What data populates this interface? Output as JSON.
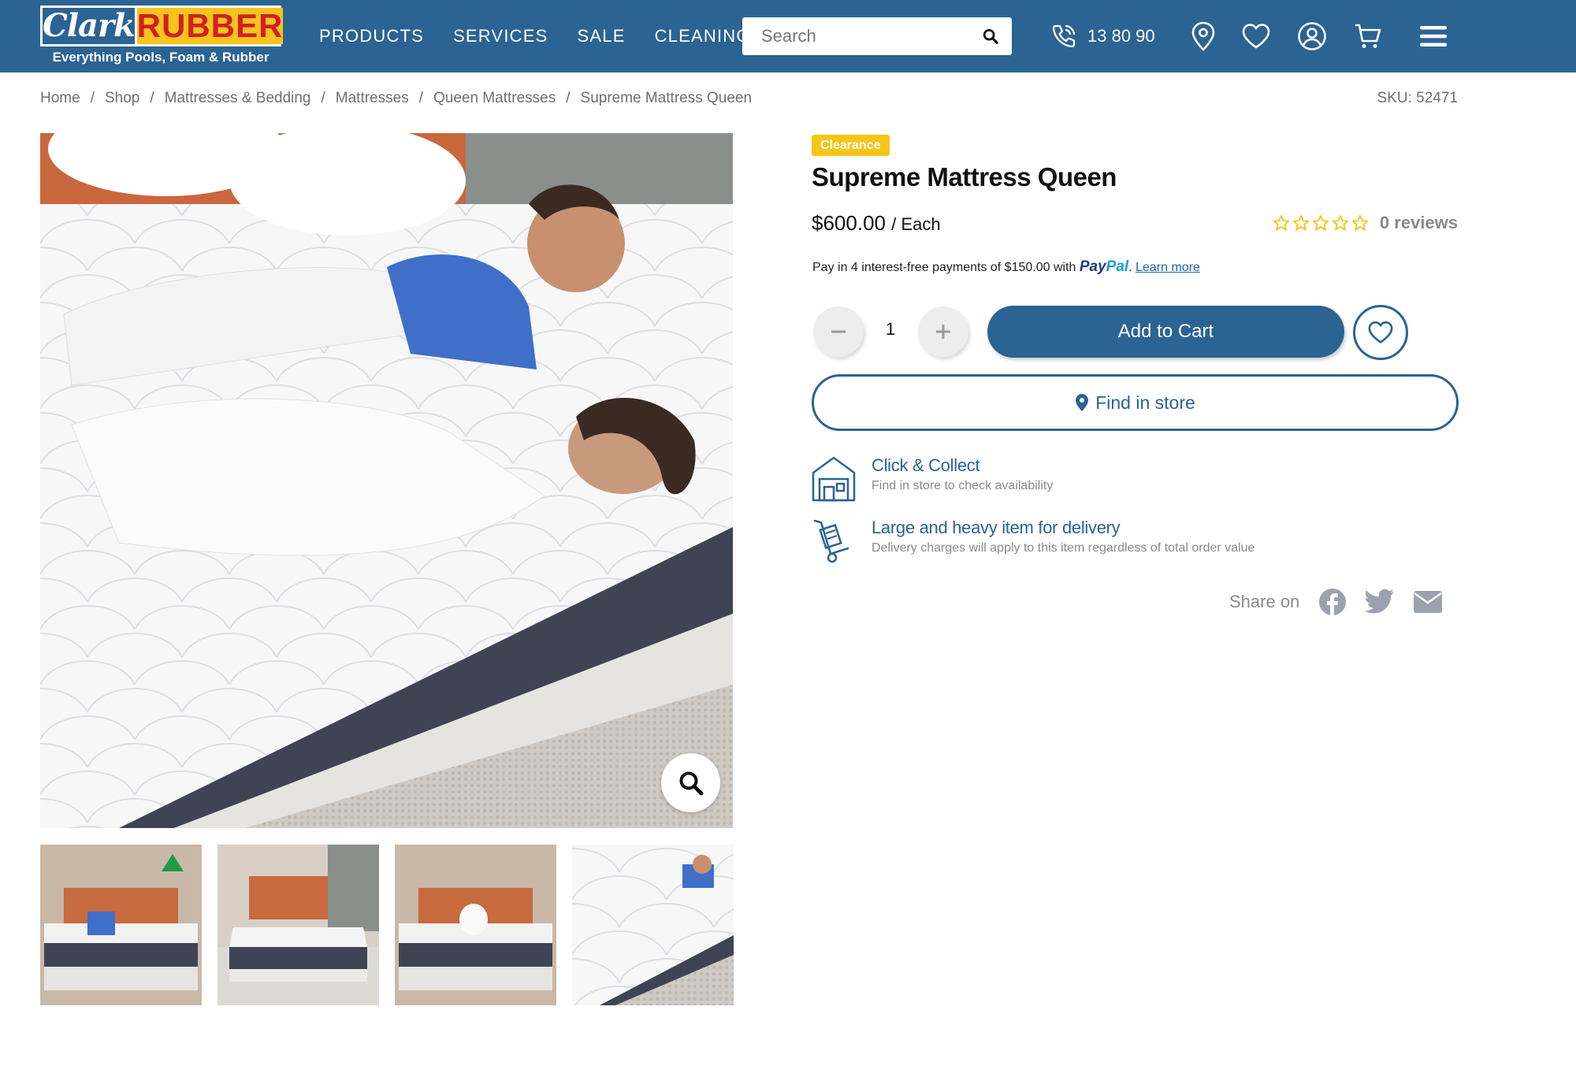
{
  "header": {
    "logo_left": "Clark",
    "logo_right": "RUBBER",
    "tagline": "Everything Pools, Foam & Rubber",
    "nav": [
      "PRODUCTS",
      "SERVICES",
      "SALE",
      "CLEANING"
    ],
    "search_placeholder": "Search",
    "phone": "13 80 90",
    "icons": [
      "search-icon",
      "phone-icon",
      "location-pin-icon",
      "heart-icon",
      "account-icon",
      "cart-icon",
      "menu-icon"
    ]
  },
  "breadcrumb": [
    "Home",
    "Shop",
    "Mattresses & Bedding",
    "Mattresses",
    "Queen Mattresses",
    "Supreme Mattress Queen"
  ],
  "sku": "SKU: 52471",
  "product": {
    "badge": "Clearance",
    "title": "Supreme Mattress Queen",
    "price": "$600.00",
    "unit": "/ Each",
    "rating": 0,
    "reviews": "0 reviews",
    "paypal_text": "Pay in 4 interest-free payments of $150.00 with",
    "paypal_brand_a": "Pay",
    "paypal_brand_b": "Pal",
    "paypal_link": "Learn more",
    "quantity": "1",
    "add_to_cart": "Add to Cart",
    "find_in_store": "Find in store"
  },
  "features": [
    {
      "title": "Click & Collect",
      "subtitle": "Find in store to check availability",
      "icon": "store-icon"
    },
    {
      "title": "Large and heavy item for delivery",
      "subtitle": "Delivery charges will apply to this item regardless of total order value",
      "icon": "hand-truck-icon"
    }
  ],
  "share": {
    "label": "Share on",
    "icons": [
      "facebook-icon",
      "twitter-icon",
      "email-icon"
    ]
  },
  "colors": {
    "brand_blue": "#2b6393",
    "logo_yellow": "#f7c31c",
    "logo_red": "#d11f26",
    "badge_yellow": "#f5c518",
    "star_yellow": "#f5c518"
  }
}
